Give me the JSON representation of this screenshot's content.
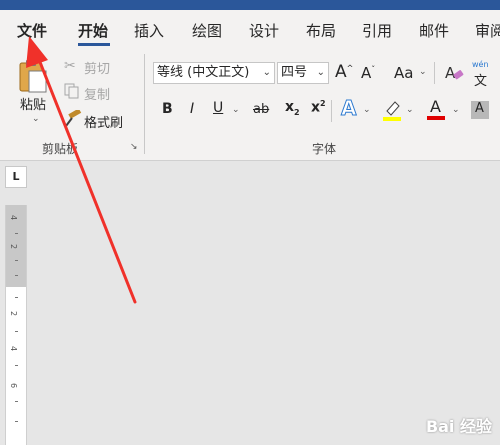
{
  "tabs": {
    "file": "文件",
    "home": "开始",
    "insert": "插入",
    "design": "绘图",
    "layout_design": "设计",
    "layout": "布局",
    "references": "引用",
    "mailings": "邮件",
    "review": "审阅"
  },
  "clipboard": {
    "paste": "粘贴",
    "cut": "剪切",
    "copy": "复制",
    "format_painter": "格式刷",
    "group_label": "剪贴板"
  },
  "font": {
    "font_name": "等线 (中文正文)",
    "font_size": "四号",
    "grow": "A",
    "shrink": "A",
    "change_case": "Aa",
    "phonetic": "wén",
    "bold": "B",
    "italic": "I",
    "underline": "U",
    "strike": "ab",
    "subscript": "x",
    "superscript": "x",
    "text_effects": "A",
    "font_color": "A",
    "char_shading": "A",
    "group_label": "字体"
  },
  "ruler": {
    "corner": "L",
    "numbers": [
      "4",
      "2",
      "2",
      "4",
      "6"
    ]
  },
  "watermark": "Bai 经验",
  "colors": {
    "title_bar": "#2b579a",
    "arrow": "#f0312a",
    "highlight": "#ffff00",
    "font_color_bar": "#e00000"
  }
}
